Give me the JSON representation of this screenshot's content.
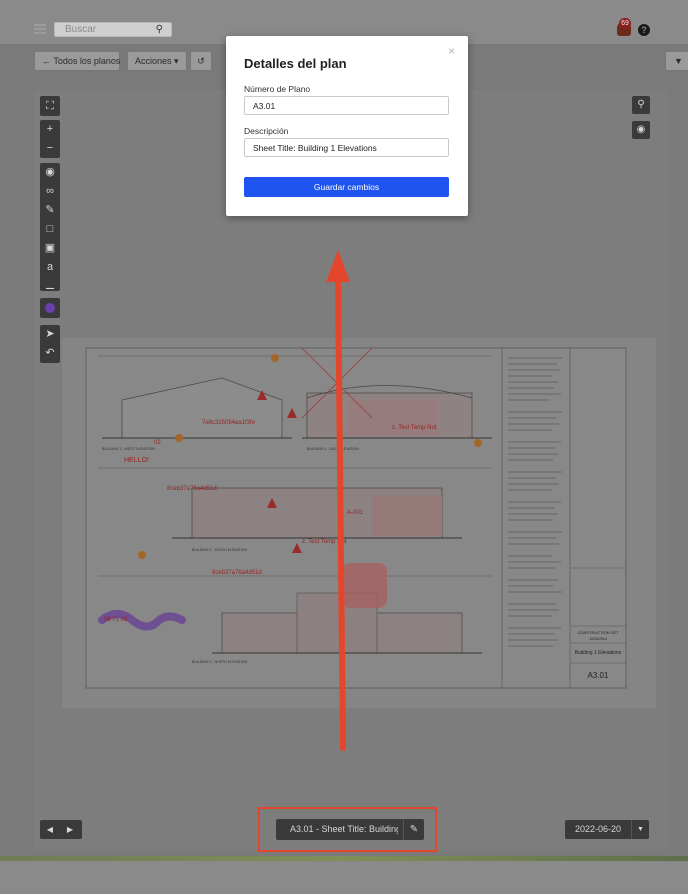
{
  "topbar": {
    "search_placeholder": "Buscar",
    "notification_count": "69"
  },
  "toolbar": {
    "back_label": "← Todos los planos",
    "actions_label": "Acciones ▾",
    "filter_label": "▼"
  },
  "modal": {
    "title": "Detalles del plan",
    "close": "×",
    "plan_number_label": "Número de Plano",
    "plan_number_value": "A3.01",
    "description_label": "Descripción",
    "description_value": "Sheet Title: Building 1 Elevations",
    "save_label": "Guardar cambios"
  },
  "bottombar": {
    "sheet_label": "A3.01 - Sheet Title: Building ...",
    "date_label": "2022-06-20"
  },
  "sheet": {
    "markups": [
      "7e8c325094aa1f3fe",
      "02",
      "HELLO!",
      "8ceb37a76a4d51d",
      "A-001",
      "z. Test Temp Not",
      "z. Test Temp Not",
      "8ceb37a76a4d51d",
      "08 71 00"
    ],
    "titleblock": {
      "set": "CONSTRUCTION SET",
      "date": "10/26/2014",
      "name": "Building 1 Elevations",
      "number": "A3.01"
    },
    "elevations": [
      "BUILDING 1 - WEST ELEVATION",
      "BUILDING 1 - EAST ELEVATION",
      "BUILDING 1 - SOUTH ELEVATION",
      "BUILDING 1 - NORTH ELEVATION"
    ]
  },
  "colors": {
    "accent": "#1f54f0",
    "highlight": "#e4462b"
  }
}
